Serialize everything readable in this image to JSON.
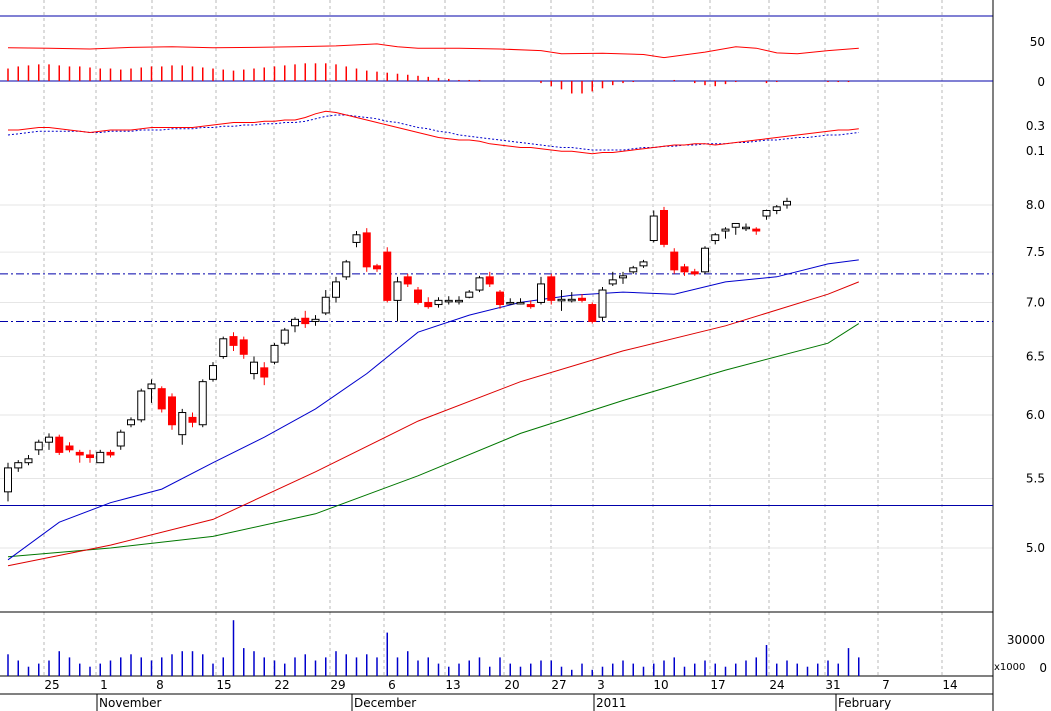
{
  "chart_data": {
    "type": "candlestick",
    "x_tick_labels": [
      "25",
      "1",
      "8",
      "15",
      "22",
      "29",
      "6",
      "13",
      "20",
      "27",
      "3",
      "10",
      "17",
      "24",
      "31",
      "7",
      "14"
    ],
    "month_labels": [
      "November",
      "December",
      "2011",
      "February"
    ],
    "volume_axis_label": "x1000",
    "price_axis": {
      "ticks": [
        "5.0",
        "5.5",
        "6.0",
        "6.5",
        "7.0",
        "7.5",
        "8.0"
      ],
      "ylim": [
        4.5,
        8.3
      ],
      "scale": "log"
    },
    "osc_top": {
      "ticks": [
        "50",
        "0"
      ]
    },
    "osc_mid": {
      "ticks": [
        "0.3",
        "0.1"
      ]
    },
    "volume_axis": {
      "ticks": [
        "30000",
        "0"
      ]
    },
    "horizontal_lines": [
      7.28,
      6.82,
      5.3
    ],
    "colors": {
      "up": "#ffffff",
      "down": "#ff0000",
      "ma20": "#0000cc",
      "ma50": "#dd0000",
      "ma100": "#007700",
      "line": "#0000aa"
    },
    "candles": [
      {
        "o": 5.4,
        "h": 5.62,
        "l": 5.33,
        "c": 5.58
      },
      {
        "o": 5.58,
        "h": 5.64,
        "l": 5.55,
        "c": 5.62
      },
      {
        "o": 5.62,
        "h": 5.68,
        "l": 5.6,
        "c": 5.65
      },
      {
        "o": 5.72,
        "h": 5.8,
        "l": 5.68,
        "c": 5.78
      },
      {
        "o": 5.78,
        "h": 5.85,
        "l": 5.72,
        "c": 5.82
      },
      {
        "o": 5.82,
        "h": 5.84,
        "l": 5.68,
        "c": 5.7
      },
      {
        "o": 5.75,
        "h": 5.78,
        "l": 5.7,
        "c": 5.72
      },
      {
        "o": 5.7,
        "h": 5.72,
        "l": 5.62,
        "c": 5.68
      },
      {
        "o": 5.68,
        "h": 5.72,
        "l": 5.62,
        "c": 5.66
      },
      {
        "o": 5.62,
        "h": 5.72,
        "l": 5.62,
        "c": 5.7
      },
      {
        "o": 5.7,
        "h": 5.72,
        "l": 5.66,
        "c": 5.68
      },
      {
        "o": 5.75,
        "h": 5.88,
        "l": 5.72,
        "c": 5.86
      },
      {
        "o": 5.92,
        "h": 5.98,
        "l": 5.9,
        "c": 5.96
      },
      {
        "o": 5.96,
        "h": 6.22,
        "l": 5.94,
        "c": 6.2
      },
      {
        "o": 6.22,
        "h": 6.3,
        "l": 6.1,
        "c": 6.26
      },
      {
        "o": 6.22,
        "h": 6.24,
        "l": 6.02,
        "c": 6.05
      },
      {
        "o": 6.15,
        "h": 6.18,
        "l": 5.88,
        "c": 5.92
      },
      {
        "o": 5.84,
        "h": 6.05,
        "l": 5.76,
        "c": 6.02
      },
      {
        "o": 5.98,
        "h": 6.02,
        "l": 5.9,
        "c": 5.94
      },
      {
        "o": 5.92,
        "h": 6.3,
        "l": 5.9,
        "c": 6.28
      },
      {
        "o": 6.3,
        "h": 6.45,
        "l": 6.28,
        "c": 6.42
      },
      {
        "o": 6.5,
        "h": 6.68,
        "l": 6.48,
        "c": 6.66
      },
      {
        "o": 6.68,
        "h": 6.72,
        "l": 6.55,
        "c": 6.6
      },
      {
        "o": 6.65,
        "h": 6.68,
        "l": 6.48,
        "c": 6.52
      },
      {
        "o": 6.35,
        "h": 6.5,
        "l": 6.3,
        "c": 6.45
      },
      {
        "o": 6.4,
        "h": 6.45,
        "l": 6.25,
        "c": 6.32
      },
      {
        "o": 6.45,
        "h": 6.62,
        "l": 6.43,
        "c": 6.6
      },
      {
        "o": 6.62,
        "h": 6.76,
        "l": 6.6,
        "c": 6.74
      },
      {
        "o": 6.78,
        "h": 6.86,
        "l": 6.72,
        "c": 6.84
      },
      {
        "o": 6.85,
        "h": 6.92,
        "l": 6.76,
        "c": 6.8
      },
      {
        "o": 6.82,
        "h": 6.88,
        "l": 6.78,
        "c": 6.84
      },
      {
        "o": 6.9,
        "h": 7.12,
        "l": 6.88,
        "c": 7.05
      },
      {
        "o": 7.05,
        "h": 7.25,
        "l": 7.0,
        "c": 7.2
      },
      {
        "o": 7.25,
        "h": 7.42,
        "l": 7.22,
        "c": 7.4
      },
      {
        "o": 7.6,
        "h": 7.72,
        "l": 7.55,
        "c": 7.68
      },
      {
        "o": 7.7,
        "h": 7.75,
        "l": 7.3,
        "c": 7.35
      },
      {
        "o": 7.36,
        "h": 7.38,
        "l": 7.3,
        "c": 7.33
      },
      {
        "o": 7.5,
        "h": 7.55,
        "l": 7.0,
        "c": 7.02
      },
      {
        "o": 7.02,
        "h": 7.25,
        "l": 6.82,
        "c": 7.2
      },
      {
        "o": 7.25,
        "h": 7.28,
        "l": 7.15,
        "c": 7.18
      },
      {
        "o": 7.12,
        "h": 7.15,
        "l": 6.98,
        "c": 7.0
      },
      {
        "o": 7.0,
        "h": 7.05,
        "l": 6.94,
        "c": 6.96
      },
      {
        "o": 6.98,
        "h": 7.05,
        "l": 6.95,
        "c": 7.02
      },
      {
        "o": 7.02,
        "h": 7.06,
        "l": 6.98,
        "c": 7.02
      },
      {
        "o": 7.02,
        "h": 7.06,
        "l": 6.98,
        "c": 7.02
      },
      {
        "o": 7.05,
        "h": 7.12,
        "l": 7.04,
        "c": 7.1
      },
      {
        "o": 7.12,
        "h": 7.26,
        "l": 7.1,
        "c": 7.24
      },
      {
        "o": 7.25,
        "h": 7.3,
        "l": 7.15,
        "c": 7.18
      },
      {
        "o": 7.1,
        "h": 7.12,
        "l": 6.94,
        "c": 6.98
      },
      {
        "o": 7.0,
        "h": 7.04,
        "l": 6.98,
        "c": 7.0
      },
      {
        "o": 7.0,
        "h": 7.04,
        "l": 6.98,
        "c": 7.0
      },
      {
        "o": 6.98,
        "h": 7.02,
        "l": 6.94,
        "c": 6.96
      },
      {
        "o": 7.0,
        "h": 7.25,
        "l": 6.98,
        "c": 7.18
      },
      {
        "o": 7.25,
        "h": 7.28,
        "l": 6.98,
        "c": 7.02
      },
      {
        "o": 7.02,
        "h": 7.12,
        "l": 6.92,
        "c": 7.03
      },
      {
        "o": 7.03,
        "h": 7.1,
        "l": 7.0,
        "c": 7.03
      },
      {
        "o": 7.04,
        "h": 7.08,
        "l": 7.0,
        "c": 7.02
      },
      {
        "o": 6.98,
        "h": 7.0,
        "l": 6.8,
        "c": 6.82
      },
      {
        "o": 6.86,
        "h": 7.15,
        "l": 6.82,
        "c": 7.12
      },
      {
        "o": 7.18,
        "h": 7.3,
        "l": 7.16,
        "c": 7.22
      },
      {
        "o": 7.24,
        "h": 7.3,
        "l": 7.18,
        "c": 7.26
      },
      {
        "o": 7.3,
        "h": 7.36,
        "l": 7.28,
        "c": 7.34
      },
      {
        "o": 7.36,
        "h": 7.42,
        "l": 7.34,
        "c": 7.4
      },
      {
        "o": 7.62,
        "h": 7.94,
        "l": 7.6,
        "c": 7.88
      },
      {
        "o": 7.94,
        "h": 7.98,
        "l": 7.55,
        "c": 7.58
      },
      {
        "o": 7.5,
        "h": 7.54,
        "l": 7.28,
        "c": 7.32
      },
      {
        "o": 7.35,
        "h": 7.38,
        "l": 7.26,
        "c": 7.3
      },
      {
        "o": 7.3,
        "h": 7.33,
        "l": 7.26,
        "c": 7.28
      },
      {
        "o": 7.3,
        "h": 7.56,
        "l": 7.28,
        "c": 7.54
      },
      {
        "o": 7.62,
        "h": 7.7,
        "l": 7.58,
        "c": 7.68
      },
      {
        "o": 7.72,
        "h": 7.76,
        "l": 7.64,
        "c": 7.74
      },
      {
        "o": 7.76,
        "h": 7.8,
        "l": 7.68,
        "c": 7.8
      },
      {
        "o": 7.76,
        "h": 7.8,
        "l": 7.72,
        "c": 7.76
      },
      {
        "o": 7.74,
        "h": 7.76,
        "l": 7.68,
        "c": 7.72
      },
      {
        "o": 7.88,
        "h": 7.95,
        "l": 7.84,
        "c": 7.94
      },
      {
        "o": 7.94,
        "h": 8.0,
        "l": 7.9,
        "c": 7.98
      },
      {
        "o": 8.0,
        "h": 8.08,
        "l": 7.96,
        "c": 8.04
      }
    ],
    "ma20": [
      {
        "x": 0,
        "y": 4.92
      },
      {
        "x": 5,
        "y": 5.18
      },
      {
        "x": 10,
        "y": 5.32
      },
      {
        "x": 15,
        "y": 5.42
      },
      {
        "x": 20,
        "y": 5.62
      },
      {
        "x": 25,
        "y": 5.82
      },
      {
        "x": 30,
        "y": 6.05
      },
      {
        "x": 35,
        "y": 6.35
      },
      {
        "x": 40,
        "y": 6.72
      },
      {
        "x": 45,
        "y": 6.88
      },
      {
        "x": 50,
        "y": 7.0
      },
      {
        "x": 55,
        "y": 7.07
      },
      {
        "x": 60,
        "y": 7.1
      },
      {
        "x": 65,
        "y": 7.08
      },
      {
        "x": 70,
        "y": 7.2
      },
      {
        "x": 75,
        "y": 7.25
      },
      {
        "x": 80,
        "y": 7.38
      },
      {
        "x": 83,
        "y": 7.42
      }
    ],
    "ma50": [
      {
        "x": 0,
        "y": 4.88
      },
      {
        "x": 10,
        "y": 5.02
      },
      {
        "x": 20,
        "y": 5.2
      },
      {
        "x": 30,
        "y": 5.55
      },
      {
        "x": 40,
        "y": 5.95
      },
      {
        "x": 50,
        "y": 6.28
      },
      {
        "x": 60,
        "y": 6.55
      },
      {
        "x": 70,
        "y": 6.78
      },
      {
        "x": 80,
        "y": 7.08
      },
      {
        "x": 83,
        "y": 7.2
      }
    ],
    "ma100": [
      {
        "x": 0,
        "y": 4.94
      },
      {
        "x": 10,
        "y": 5.0
      },
      {
        "x": 20,
        "y": 5.08
      },
      {
        "x": 30,
        "y": 5.24
      },
      {
        "x": 40,
        "y": 5.52
      },
      {
        "x": 50,
        "y": 5.85
      },
      {
        "x": 60,
        "y": 6.12
      },
      {
        "x": 70,
        "y": 6.38
      },
      {
        "x": 80,
        "y": 6.62
      },
      {
        "x": 83,
        "y": 6.8
      }
    ],
    "osc_line": [
      {
        "x": 0,
        "y": 85
      },
      {
        "x": 4,
        "y": 84
      },
      {
        "x": 8,
        "y": 82
      },
      {
        "x": 12,
        "y": 86
      },
      {
        "x": 16,
        "y": 88
      },
      {
        "x": 20,
        "y": 85
      },
      {
        "x": 24,
        "y": 86
      },
      {
        "x": 28,
        "y": 88
      },
      {
        "x": 32,
        "y": 90
      },
      {
        "x": 36,
        "y": 95
      },
      {
        "x": 38,
        "y": 88
      },
      {
        "x": 40,
        "y": 84
      },
      {
        "x": 44,
        "y": 84
      },
      {
        "x": 48,
        "y": 82
      },
      {
        "x": 52,
        "y": 78
      },
      {
        "x": 54,
        "y": 70
      },
      {
        "x": 58,
        "y": 71
      },
      {
        "x": 62,
        "y": 68
      },
      {
        "x": 64,
        "y": 60
      },
      {
        "x": 68,
        "y": 74
      },
      {
        "x": 71,
        "y": 88
      },
      {
        "x": 73,
        "y": 84
      },
      {
        "x": 75,
        "y": 72
      },
      {
        "x": 77,
        "y": 70
      },
      {
        "x": 80,
        "y": 78
      },
      {
        "x": 83,
        "y": 84
      }
    ],
    "osc_hist": [
      12,
      14,
      15,
      16,
      16,
      15,
      14,
      14,
      13,
      12,
      12,
      11,
      12,
      13,
      14,
      14,
      15,
      15,
      14,
      13,
      12,
      11,
      10,
      11,
      12,
      13,
      14,
      15,
      16,
      17,
      17,
      17,
      16,
      14,
      12,
      10,
      9,
      8,
      7,
      6,
      5,
      4,
      3,
      2,
      1,
      1,
      1,
      0,
      0,
      0,
      0,
      0,
      -2,
      -5,
      -8,
      -12,
      -12,
      -10,
      -7,
      -4,
      -2,
      -1,
      0,
      0,
      0,
      1,
      0,
      -2,
      -4,
      -5,
      -3,
      -1,
      0,
      0,
      -2,
      -1,
      0,
      0,
      0,
      0,
      -1,
      -1,
      -1,
      0
    ],
    "macd_line": [
      0.26,
      0.26,
      0.27,
      0.28,
      0.28,
      0.27,
      0.26,
      0.25,
      0.24,
      0.25,
      0.26,
      0.26,
      0.26,
      0.27,
      0.28,
      0.28,
      0.28,
      0.28,
      0.28,
      0.29,
      0.3,
      0.31,
      0.32,
      0.32,
      0.32,
      0.33,
      0.33,
      0.34,
      0.34,
      0.36,
      0.39,
      0.41,
      0.4,
      0.38,
      0.36,
      0.34,
      0.32,
      0.3,
      0.28,
      0.26,
      0.24,
      0.22,
      0.2,
      0.19,
      0.18,
      0.18,
      0.17,
      0.15,
      0.14,
      0.13,
      0.12,
      0.12,
      0.11,
      0.1,
      0.09,
      0.09,
      0.08,
      0.07,
      0.08,
      0.08,
      0.09,
      0.1,
      0.11,
      0.12,
      0.13,
      0.14,
      0.14,
      0.15,
      0.15,
      0.14,
      0.15,
      0.16,
      0.17,
      0.18,
      0.19,
      0.2,
      0.21,
      0.22,
      0.23,
      0.24,
      0.25,
      0.26,
      0.26,
      0.27
    ],
    "macd_signal": [
      0.22,
      0.23,
      0.24,
      0.25,
      0.25,
      0.25,
      0.25,
      0.25,
      0.24,
      0.24,
      0.25,
      0.25,
      0.25,
      0.26,
      0.26,
      0.26,
      0.27,
      0.27,
      0.27,
      0.28,
      0.28,
      0.29,
      0.29,
      0.3,
      0.3,
      0.31,
      0.31,
      0.32,
      0.32,
      0.33,
      0.35,
      0.37,
      0.38,
      0.38,
      0.37,
      0.36,
      0.35,
      0.33,
      0.32,
      0.3,
      0.28,
      0.27,
      0.25,
      0.24,
      0.22,
      0.21,
      0.2,
      0.19,
      0.18,
      0.17,
      0.16,
      0.15,
      0.14,
      0.13,
      0.12,
      0.12,
      0.11,
      0.1,
      0.1,
      0.1,
      0.1,
      0.11,
      0.12,
      0.12,
      0.13,
      0.13,
      0.14,
      0.14,
      0.15,
      0.15,
      0.15,
      0.16,
      0.16,
      0.17,
      0.18,
      0.18,
      0.19,
      0.2,
      0.2,
      0.21,
      0.22,
      0.22,
      0.23,
      0.24
    ],
    "volume": [
      7,
      5,
      3,
      4,
      5,
      8,
      6,
      4,
      3,
      4,
      5,
      6,
      7,
      6,
      5,
      6,
      7,
      8,
      8,
      7,
      4,
      6,
      18,
      9,
      8,
      6,
      5,
      4,
      6,
      7,
      5,
      6,
      8,
      7,
      6,
      7,
      6,
      14,
      6,
      8,
      5,
      6,
      4,
      3,
      4,
      5,
      6,
      3,
      6,
      4,
      3,
      4,
      5,
      5,
      3,
      2,
      4,
      2,
      3,
      4,
      5,
      4,
      3,
      4,
      5,
      6,
      3,
      4,
      5,
      4,
      3,
      4,
      5,
      6,
      10,
      4,
      5,
      4,
      3,
      4,
      5,
      4,
      9,
      6
    ]
  }
}
